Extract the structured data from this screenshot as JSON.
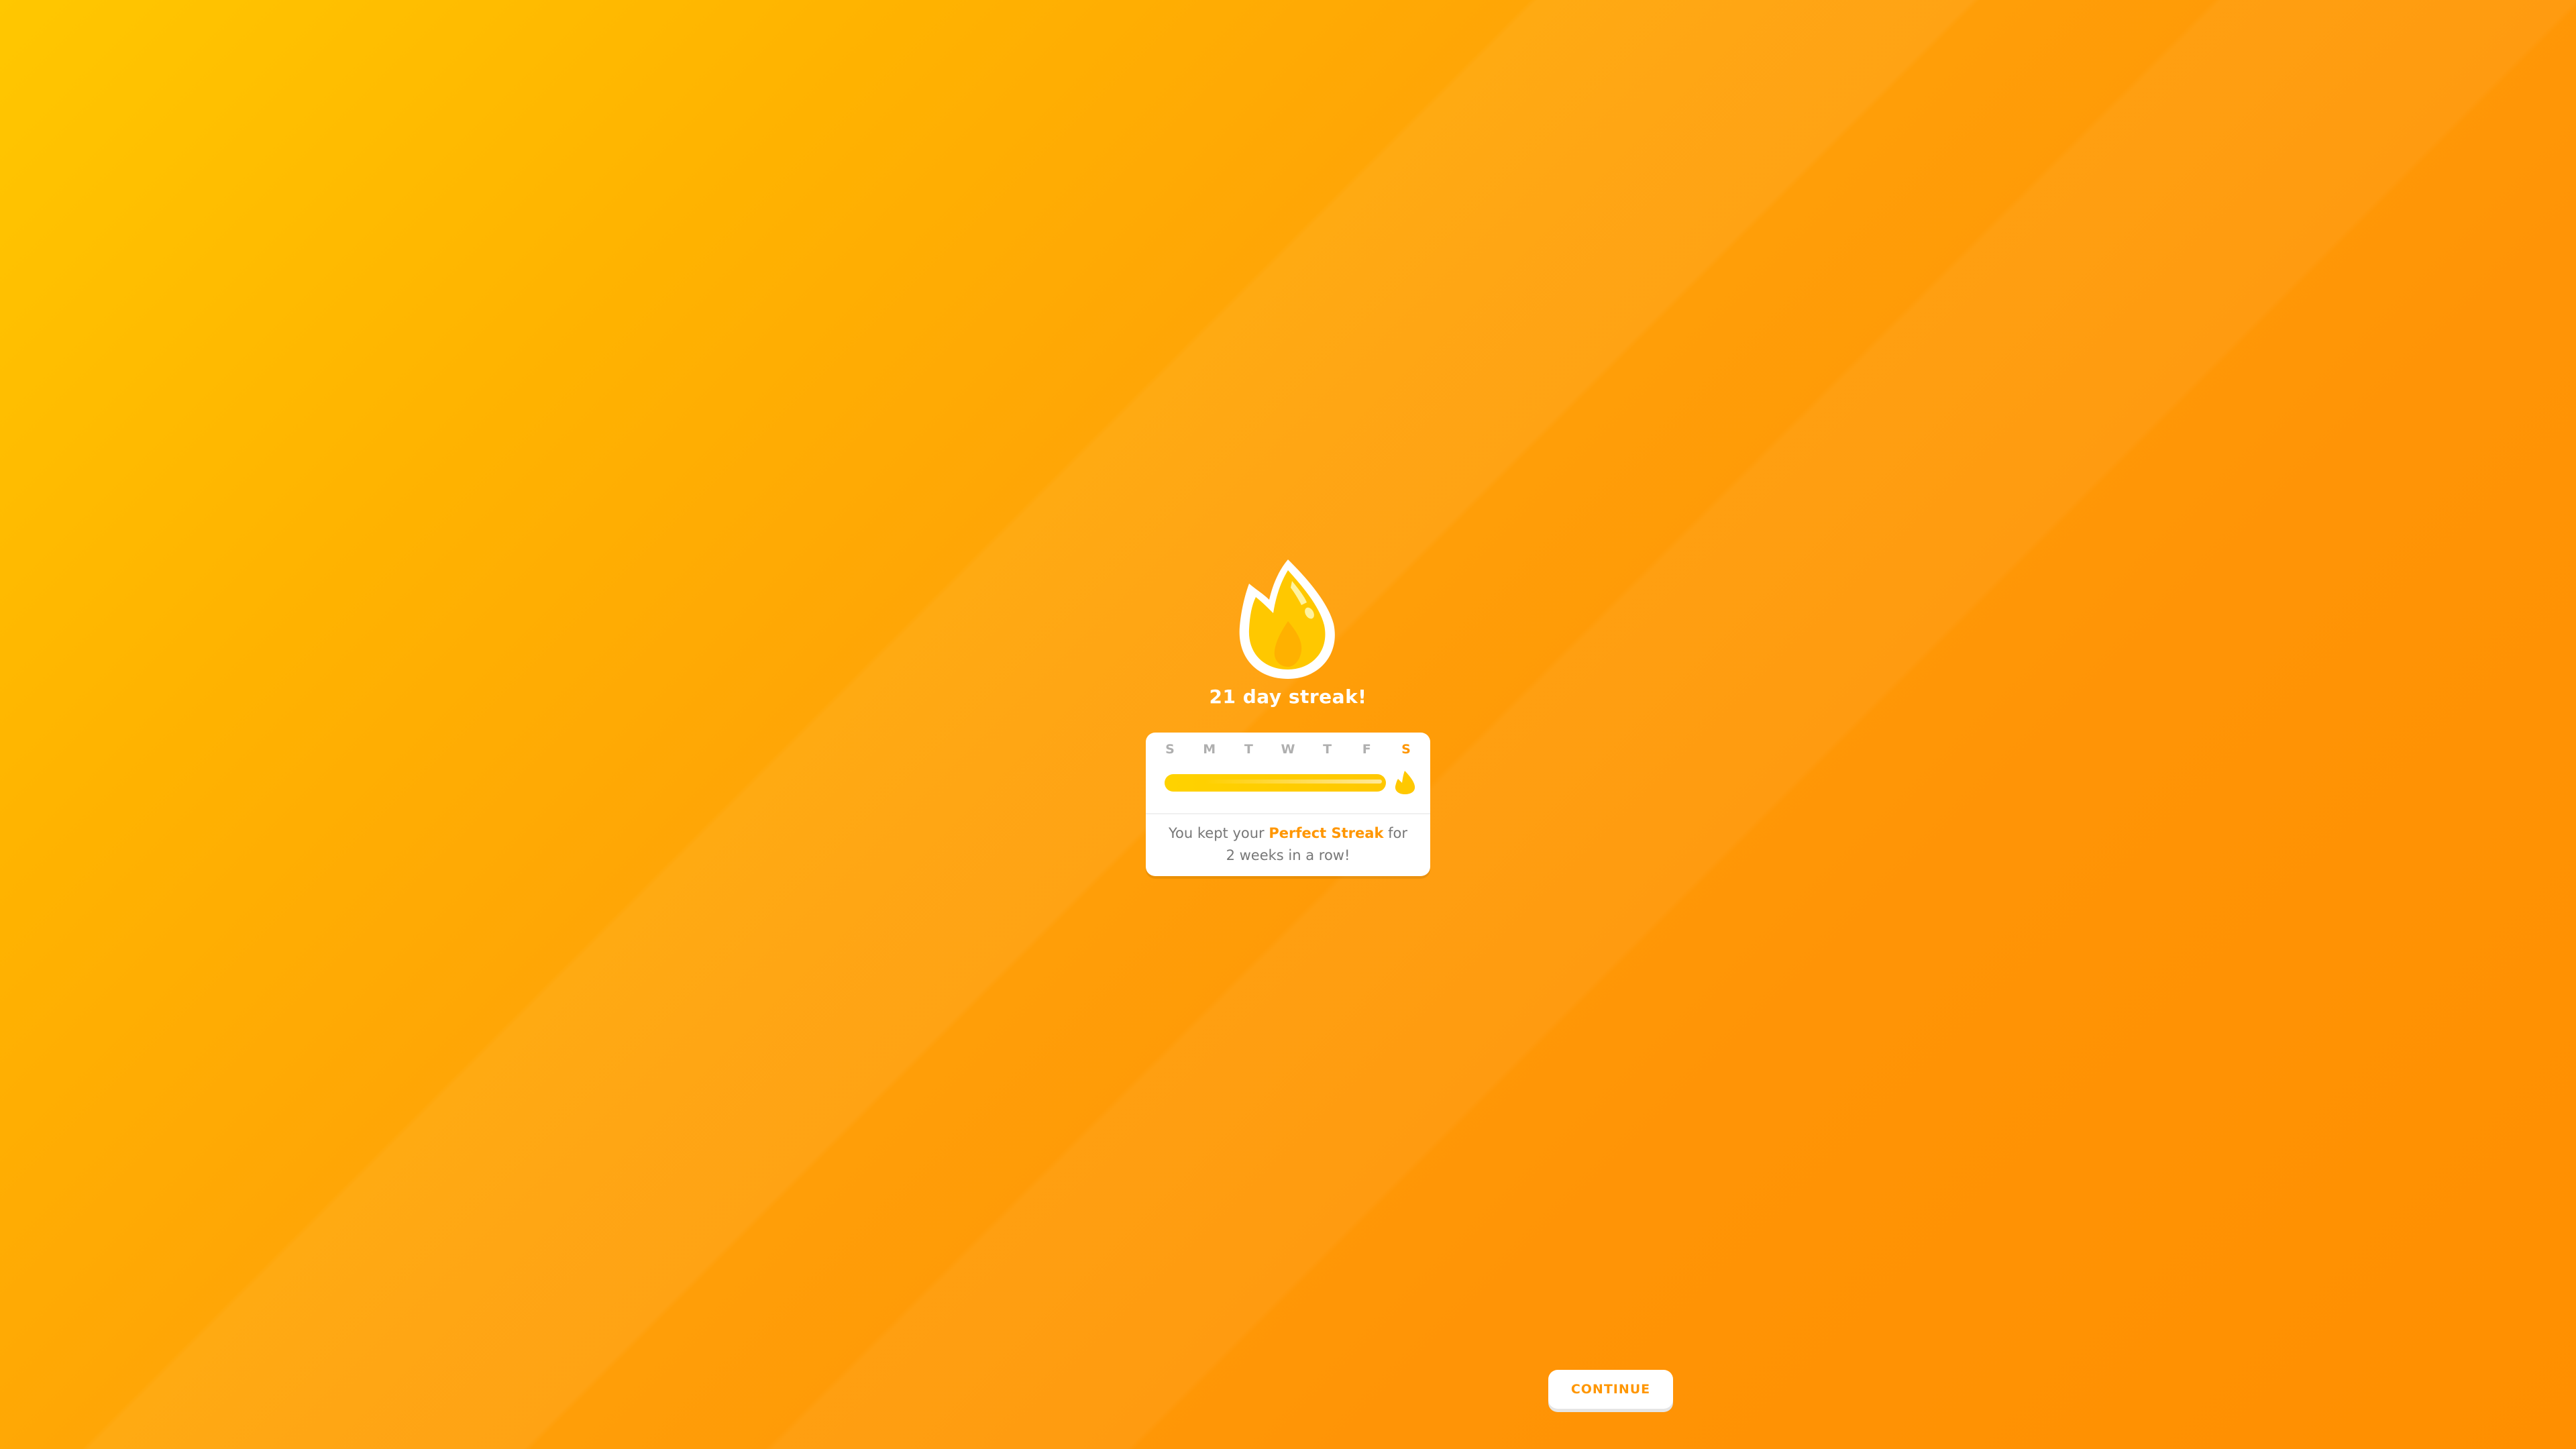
{
  "streak": {
    "title": "21 day streak!",
    "icon": "flame-icon",
    "days": [
      {
        "label": "S",
        "active": false
      },
      {
        "label": "M",
        "active": false
      },
      {
        "label": "T",
        "active": false
      },
      {
        "label": "W",
        "active": false
      },
      {
        "label": "T",
        "active": false
      },
      {
        "label": "F",
        "active": false
      },
      {
        "label": "S",
        "active": true
      }
    ],
    "progress": 1.0,
    "message_prefix": "You kept your ",
    "message_highlight": "Perfect Streak",
    "message_suffix": " for 2 weeks in a row!"
  },
  "footer": {
    "continue_label": "CONTINUE"
  },
  "colors": {
    "accent": "#ff9600",
    "flame_yellow": "#ffc800",
    "background_top": "#ffc700",
    "background_bottom": "#ff8f00"
  }
}
